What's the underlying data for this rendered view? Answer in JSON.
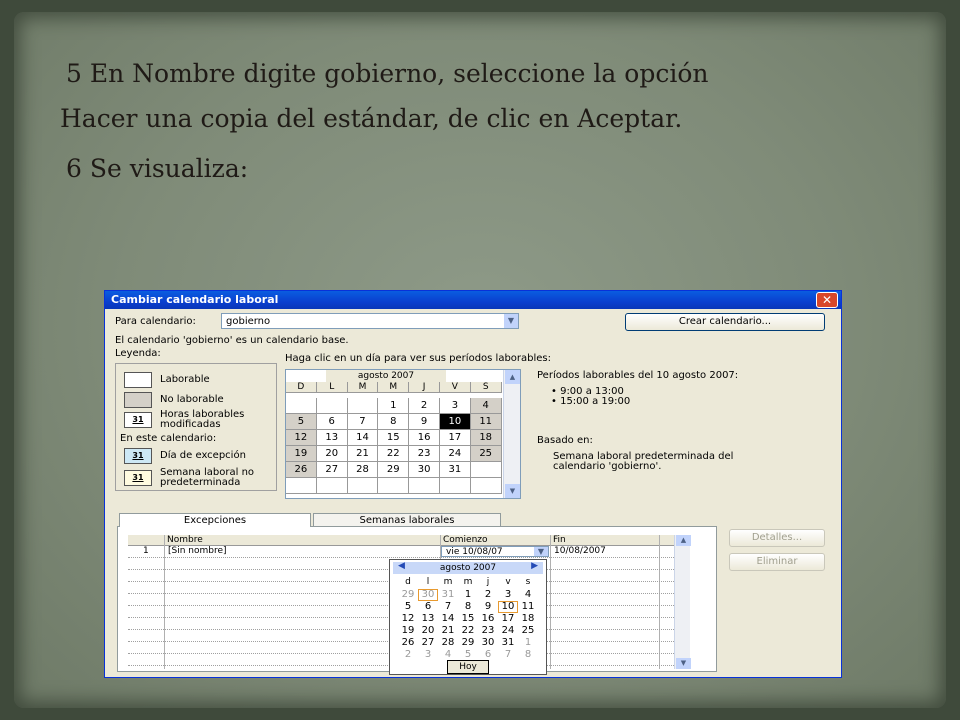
{
  "slide": {
    "line1": "5  En Nombre digite gobierno, seleccione la opción",
    "line2": "Hacer una copia del estándar, de clic en Aceptar.",
    "line3": "6  Se visualiza:"
  },
  "window": {
    "title": "Cambiar calendario laboral",
    "close_icon": "✕",
    "para_calendario_label": "Para calendario:",
    "calendar_value": "gobierno",
    "crear_button": "Crear calendario...",
    "base_info": "El calendario 'gobierno' es un calendario base.",
    "leyenda_label": "Leyenda:",
    "legend": {
      "laborable": "Laborable",
      "no_laborable": "No laborable",
      "horas_mod_1": "Horas laborables",
      "horas_mod_2": "modificadas",
      "en_este": "En este calendario:",
      "excepcion": "Día de excepción",
      "semana_1": "Semana laboral no",
      "semana_2": "predeterminada",
      "swatch_num": "31"
    },
    "haga_clic": "Haga clic en un día para ver sus períodos laborables:",
    "calendar": {
      "month": "agosto 2007",
      "weekdays": [
        "D",
        "L",
        "M",
        "M",
        "J",
        "V",
        "S"
      ],
      "weeks": [
        [
          "",
          "",
          "",
          "1",
          "2",
          "3",
          "4"
        ],
        [
          "5",
          "6",
          "7",
          "8",
          "9",
          "10",
          "11"
        ],
        [
          "12",
          "13",
          "14",
          "15",
          "16",
          "17",
          "18"
        ],
        [
          "19",
          "20",
          "21",
          "22",
          "23",
          "24",
          "25"
        ],
        [
          "26",
          "27",
          "28",
          "29",
          "30",
          "31",
          ""
        ],
        [
          "",
          "",
          "",
          "",
          "",
          "",
          ""
        ]
      ]
    },
    "periodos_title": "Períodos laborables del 10 agosto 2007:",
    "periodos": [
      "9:00 a 13:00",
      "15:00 a 19:00"
    ],
    "basado_en_label": "Basado en:",
    "basado_1": "Semana laboral predeterminada del",
    "basado_2": "calendario 'gobierno'.",
    "tabs": [
      "Excepciones",
      "Semanas laborales"
    ],
    "table": {
      "headers": [
        "Nombre",
        "Comienzo",
        "Fin"
      ],
      "row_num": "1",
      "row_nombre": "[Sin nombre]",
      "row_comienzo": "vie 10/08/07",
      "row_fin": "10/08/2007"
    },
    "detalles_button": "Detalles...",
    "eliminar_button": "Eliminar",
    "picker": {
      "month": "agosto 2007",
      "weekdays": [
        "d",
        "l",
        "m",
        "m",
        "j",
        "v",
        "s"
      ],
      "weeks": [
        [
          "29",
          "30",
          "31",
          "1",
          "2",
          "3",
          "4"
        ],
        [
          "5",
          "6",
          "7",
          "8",
          "9",
          "10",
          "11"
        ],
        [
          "12",
          "13",
          "14",
          "15",
          "16",
          "17",
          "18"
        ],
        [
          "19",
          "20",
          "21",
          "22",
          "23",
          "24",
          "25"
        ],
        [
          "26",
          "27",
          "28",
          "29",
          "30",
          "31",
          "1"
        ],
        [
          "2",
          "3",
          "4",
          "5",
          "6",
          "7",
          "8"
        ]
      ],
      "hoy": "Hoy"
    }
  }
}
